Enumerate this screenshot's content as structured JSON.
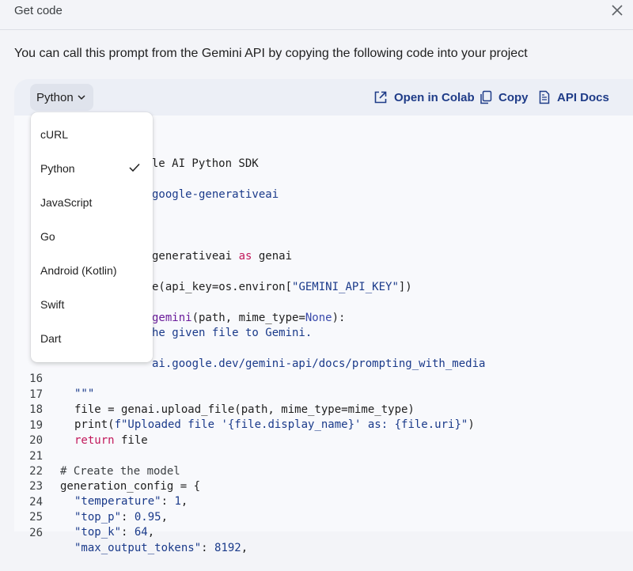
{
  "dialog": {
    "title": "Get code",
    "intro": "You can call this prompt from the Gemini API by copying the following code into your project"
  },
  "toolbar": {
    "language": "Python",
    "open_colab": "Open in Colab",
    "copy": "Copy",
    "api_docs": "API Docs"
  },
  "language_menu": {
    "items": [
      "cURL",
      "Python",
      "JavaScript",
      "Go",
      "Android (Kotlin)",
      "Swift",
      "Dart"
    ],
    "selected": "Python"
  },
  "code_visible": {
    "l1": "ogle AI Python SDK",
    "l2": "google-generativeai",
    "l3a": "generativeai ",
    "l3b": "as",
    "l3c": " genai",
    "l4a": "e(api_key=os.environ[",
    "l4b": "\"GEMINI_API_KEY\"",
    "l4c": "])",
    "l5a": "gemini",
    "l5b": "(path, mime_type=",
    "l5c": "None",
    "l5d": "):",
    "l6": "he given file to Gemini.",
    "l7": "ai.google.dev/gemini-api/docs/prompting_with_media"
  },
  "code_lines": [
    {
      "n": "16",
      "text": "\"\"\""
    },
    {
      "n": "17",
      "text": "file = genai.upload_file(path, mime_type=mime_type)"
    },
    {
      "n": "18",
      "a": "print(",
      "b": "f\"Uploaded file '{file.display_name}' as: {file.uri}\"",
      "c": ")"
    },
    {
      "n": "19",
      "a": "return",
      "c": " file"
    },
    {
      "n": "20",
      "text": ""
    },
    {
      "n": "21",
      "text": "# Create the model"
    },
    {
      "n": "22",
      "text": "generation_config = {"
    },
    {
      "n": "23",
      "a": "\"temperature\"",
      "b": ": ",
      "c": "1",
      "d": ","
    },
    {
      "n": "24",
      "a": "\"top_p\"",
      "b": ": ",
      "c": "0.95",
      "d": ","
    },
    {
      "n": "25",
      "a": "\"top_k\"",
      "b": ": ",
      "c": "64",
      "d": ","
    },
    {
      "n": "26",
      "a": "\"max_output_tokens\"",
      "b": ": ",
      "c": "8192",
      "d": ","
    }
  ]
}
